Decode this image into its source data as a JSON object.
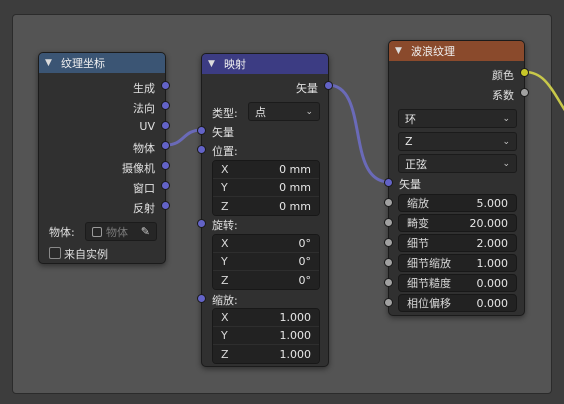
{
  "texture_coordinate": {
    "title": "纹理坐标",
    "outputs": [
      "生成",
      "法向",
      "UV",
      "物体",
      "摄像机",
      "窗口",
      "反射"
    ],
    "object_label": "物体:",
    "object_placeholder": "物体",
    "from_instancer": "来自实例"
  },
  "mapping": {
    "title": "映射",
    "output": "矢量",
    "type_label": "类型:",
    "type_value": "点",
    "vector_input": "矢量",
    "location_label": "位置:",
    "location": [
      {
        "axis": "X",
        "value": "0 mm"
      },
      {
        "axis": "Y",
        "value": "0 mm"
      },
      {
        "axis": "Z",
        "value": "0 mm"
      }
    ],
    "rotation_label": "旋转:",
    "rotation": [
      {
        "axis": "X",
        "value": "0°"
      },
      {
        "axis": "Y",
        "value": "0°"
      },
      {
        "axis": "Z",
        "value": "0°"
      }
    ],
    "scale_label": "缩放:",
    "scale": [
      {
        "axis": "X",
        "value": "1.000"
      },
      {
        "axis": "Y",
        "value": "1.000"
      },
      {
        "axis": "Z",
        "value": "1.000"
      }
    ]
  },
  "wave_texture": {
    "title": "波浪纹理",
    "outputs": [
      "颜色",
      "系数"
    ],
    "wave_type": "环",
    "direction": "Z",
    "profile": "正弦",
    "vector_input": "矢量",
    "inputs": [
      {
        "label": "缩放",
        "value": "5.000"
      },
      {
        "label": "畸变",
        "value": "20.000"
      },
      {
        "label": "细节",
        "value": "2.000"
      },
      {
        "label": "细节缩放",
        "value": "1.000"
      },
      {
        "label": "细节糙度",
        "value": "0.000"
      },
      {
        "label": "相位偏移",
        "value": "0.000"
      }
    ]
  },
  "colors": {
    "editor_bg": "#545454",
    "node_bg": "#303030",
    "texcoord_header": "#3b5574",
    "mapping_header": "#3c3c83",
    "wave_header": "#8a4a2c",
    "vector_socket": "#6363c7",
    "color_socket": "#c7c729",
    "float_socket": "#a1a1a1",
    "vector_link": "#6a6ab8",
    "color_link": "#c8c84a"
  }
}
